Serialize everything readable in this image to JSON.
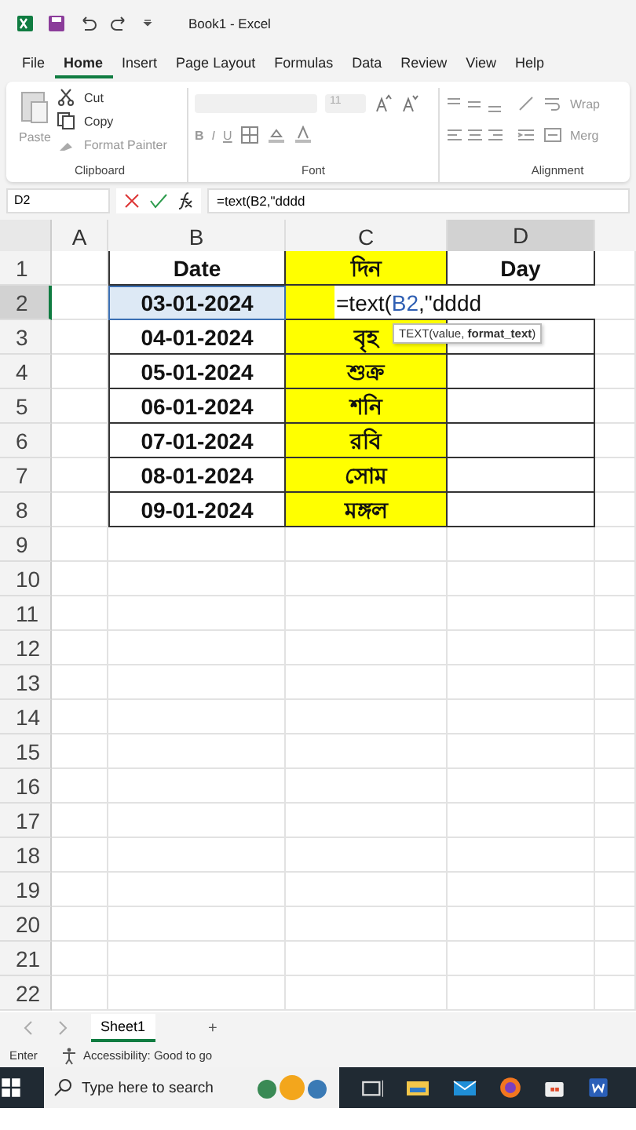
{
  "title_bar": {
    "title": "Book1  -  Excel"
  },
  "menu_tabs": [
    {
      "label": "File",
      "selected": false
    },
    {
      "label": "Home",
      "selected": true
    },
    {
      "label": "Insert",
      "selected": false
    },
    {
      "label": "Page Layout",
      "selected": false
    },
    {
      "label": "Formulas",
      "selected": false
    },
    {
      "label": "Data",
      "selected": false
    },
    {
      "label": "Review",
      "selected": false
    },
    {
      "label": "View",
      "selected": false
    },
    {
      "label": "Help",
      "selected": false
    }
  ],
  "ribbon": {
    "clipboard": {
      "paste": "Paste",
      "cut": "Cut",
      "copy": "Copy",
      "format_painter": "Format Painter",
      "label": "Clipboard"
    },
    "font": {
      "size": "11",
      "label": "Font",
      "bold": "B",
      "italic": "I",
      "underline": "U"
    },
    "alignment": {
      "wrap": "Wrap",
      "merge": "Merg",
      "label": "Alignment"
    }
  },
  "formula_bar": {
    "name_box": "D2",
    "formula": "=text(B2,\"dddd"
  },
  "columns": [
    {
      "label": "A",
      "selected": false
    },
    {
      "label": "B",
      "selected": false
    },
    {
      "label": "C",
      "selected": false
    },
    {
      "label": "D",
      "selected": true
    }
  ],
  "rows": [
    {
      "number": "1",
      "selected": false,
      "b": "Date",
      "c": "দিন",
      "d": "Day"
    },
    {
      "number": "2",
      "selected": true,
      "b": "03-01-2024"
    },
    {
      "number": "3",
      "selected": false,
      "b": "04-01-2024",
      "c": "বৃহ"
    },
    {
      "number": "4",
      "selected": false,
      "b": "05-01-2024",
      "c": "শুক্র"
    },
    {
      "number": "5",
      "selected": false,
      "b": "06-01-2024",
      "c": "শনি"
    },
    {
      "number": "6",
      "selected": false,
      "b": "07-01-2024",
      "c": "রবি"
    },
    {
      "number": "7",
      "selected": false,
      "b": "08-01-2024",
      "c": "সোম"
    },
    {
      "number": "8",
      "selected": false,
      "b": "09-01-2024",
      "c": "মঙ্গল"
    },
    {
      "number": "9",
      "selected": false
    },
    {
      "number": "10",
      "selected": false
    },
    {
      "number": "11",
      "selected": false
    },
    {
      "number": "12",
      "selected": false
    },
    {
      "number": "13",
      "selected": false
    },
    {
      "number": "14",
      "selected": false
    },
    {
      "number": "15",
      "selected": false
    },
    {
      "number": "16",
      "selected": false
    },
    {
      "number": "17",
      "selected": false
    },
    {
      "number": "18",
      "selected": false
    },
    {
      "number": "19",
      "selected": false
    },
    {
      "number": "20",
      "selected": false
    },
    {
      "number": "21",
      "selected": false
    },
    {
      "number": "22",
      "selected": false
    }
  ],
  "cell_edit": {
    "prefix": "=text(",
    "reference": "B2",
    "suffix": ",\"dddd"
  },
  "tooltip": "TEXT(value, **format_text**)",
  "sheet_tabs": [
    {
      "label": "Sheet1",
      "selected": true
    }
  ],
  "add_sheet": "+",
  "status_bar": {
    "mode": "Enter",
    "accessibility": "Accessibility: Good to go"
  },
  "taskbar": {
    "search_placeholder": "Type here to search"
  }
}
